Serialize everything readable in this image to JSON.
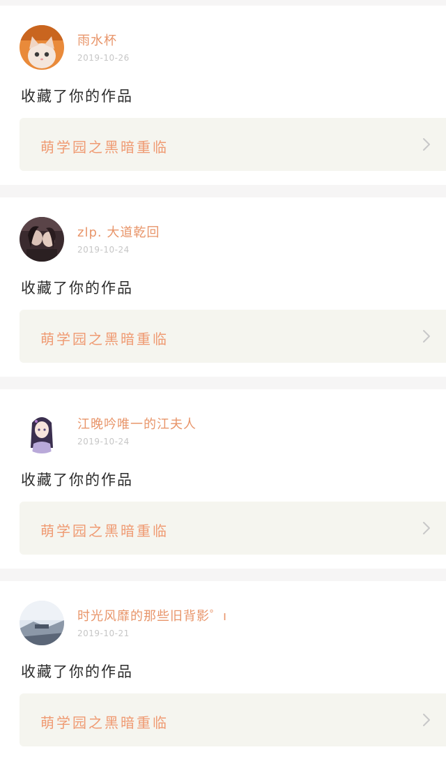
{
  "feed": {
    "items": [
      {
        "user_name": "雨水杯",
        "date": "2019-10-26",
        "action": "收藏了你的作品",
        "work_title": "萌学园之黑暗重临",
        "avatar_icon": "cat-avatar",
        "avatar_colors": [
          "#e98a3a",
          "#f3d2b0"
        ]
      },
      {
        "user_name": "zlp. 大道乾回",
        "date": "2019-10-24",
        "action": "收藏了你的作品",
        "work_title": "萌学园之黑暗重临",
        "avatar_icon": "two-women-photo-avatar",
        "avatar_colors": [
          "#3a2a2e",
          "#d9c1b6"
        ]
      },
      {
        "user_name": "江晚吟唯一的江夫人",
        "date": "2019-10-24",
        "action": "收藏了你的作品",
        "work_title": "萌学园之黑暗重临",
        "avatar_icon": "anime-girl-avatar",
        "avatar_colors": [
          "#ffffff",
          "#5a4a7a"
        ]
      },
      {
        "user_name": "时光风靡的那些旧背影゜ı",
        "date": "2019-10-21",
        "action": "收藏了你的作品",
        "work_title": "萌学园之黑暗重临",
        "avatar_icon": "landscape-photo-avatar",
        "avatar_colors": [
          "#cfd8e6",
          "#4a5566"
        ]
      }
    ]
  },
  "colors": {
    "name": "#e8956a",
    "work_title": "#ef9a72",
    "work_bg": "#f5f5ef",
    "page_bg": "#f6f5f5"
  }
}
